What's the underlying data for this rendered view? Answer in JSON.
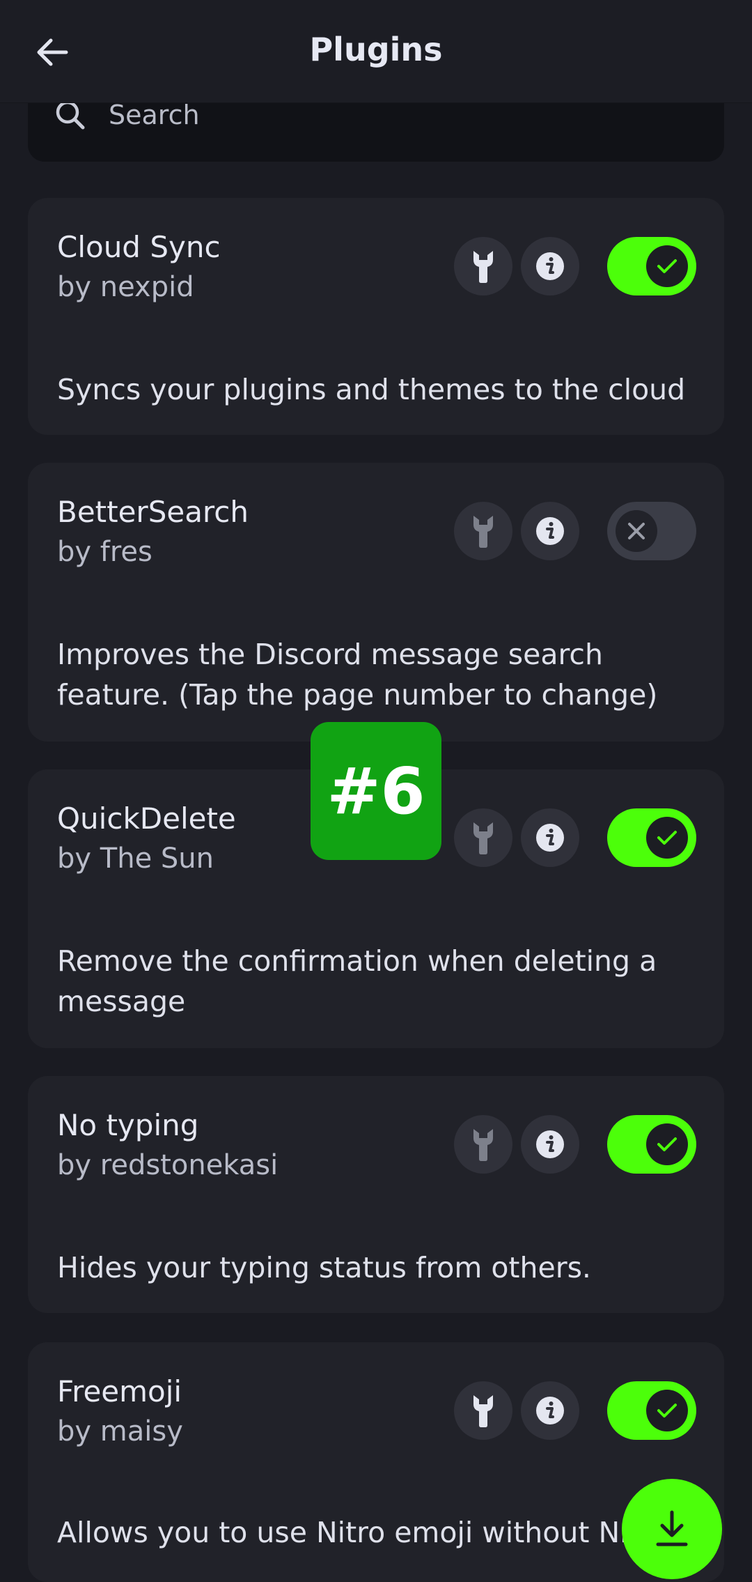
{
  "header": {
    "title": "Plugins",
    "back_icon": "arrow-left-icon"
  },
  "search": {
    "placeholder": "Search",
    "icon": "search-icon"
  },
  "colors": {
    "accent": "#4cff0a",
    "badge": "#11a313",
    "card_bg": "#212229",
    "page_bg": "#1a1b22"
  },
  "badge": {
    "label": "#6"
  },
  "plugins": [
    {
      "name": "Cloud Sync",
      "author": "by nexpid",
      "description": [
        "Syncs your plugins and themes to the cloud"
      ],
      "enabled": true
    },
    {
      "name": "BetterSearch",
      "author": "by fres",
      "description": [
        "Improves the Discord message search",
        "feature. (Tap the page number to change)"
      ],
      "enabled": false
    },
    {
      "name": "QuickDelete",
      "author": "by The Sun",
      "description": [
        "Remove the confirmation when deleting a",
        "message"
      ],
      "enabled": true
    },
    {
      "name": "No typing",
      "author": "by redstonekasi",
      "description": [
        "Hides your typing status from others."
      ],
      "enabled": true
    },
    {
      "name": "Freemoji",
      "author": "by maisy",
      "description": [
        "Allows you to use Nitro emoji without Ni"
      ],
      "enabled": true
    }
  ],
  "fab": {
    "icon": "download-icon"
  }
}
